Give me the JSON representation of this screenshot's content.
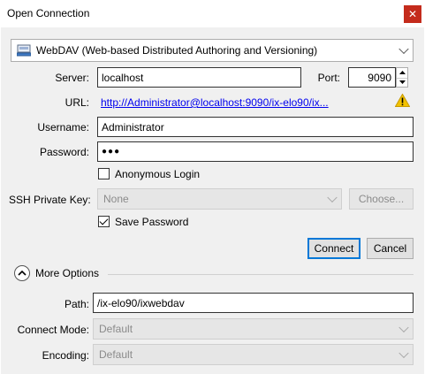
{
  "window": {
    "title": "Open Connection",
    "close_glyph": "✕"
  },
  "protocol": {
    "selected": "WebDAV (Web-based Distributed Authoring and Versioning)",
    "icon": "webdav-drive-icon"
  },
  "server": {
    "label": "Server:",
    "value": "localhost"
  },
  "port": {
    "label": "Port:",
    "value": "9090"
  },
  "url": {
    "label": "URL:",
    "value": "http://Administrator@localhost:9090/ix-elo90/ix...",
    "warning_icon": "warning-icon"
  },
  "username": {
    "label": "Username:",
    "value": "Administrator"
  },
  "password": {
    "label": "Password:",
    "value": "●●●"
  },
  "anonymous": {
    "label": "Anonymous Login",
    "checked": false
  },
  "ssh": {
    "label": "SSH Private Key:",
    "value": "None",
    "choose_label": "Choose..."
  },
  "save_password": {
    "label": "Save Password",
    "checked": true
  },
  "buttons": {
    "connect": "Connect",
    "cancel": "Cancel"
  },
  "more_options": {
    "label": "More Options"
  },
  "path": {
    "label": "Path:",
    "value": "/ix-elo90/ixwebdav"
  },
  "connect_mode": {
    "label": "Connect Mode:",
    "value": "Default"
  },
  "encoding": {
    "label": "Encoding:",
    "value": "Default"
  },
  "colors": {
    "close_bg": "#c42b1c",
    "link": "#0000ee",
    "default_button_border": "#0078d7",
    "warning": "#f2c200"
  }
}
